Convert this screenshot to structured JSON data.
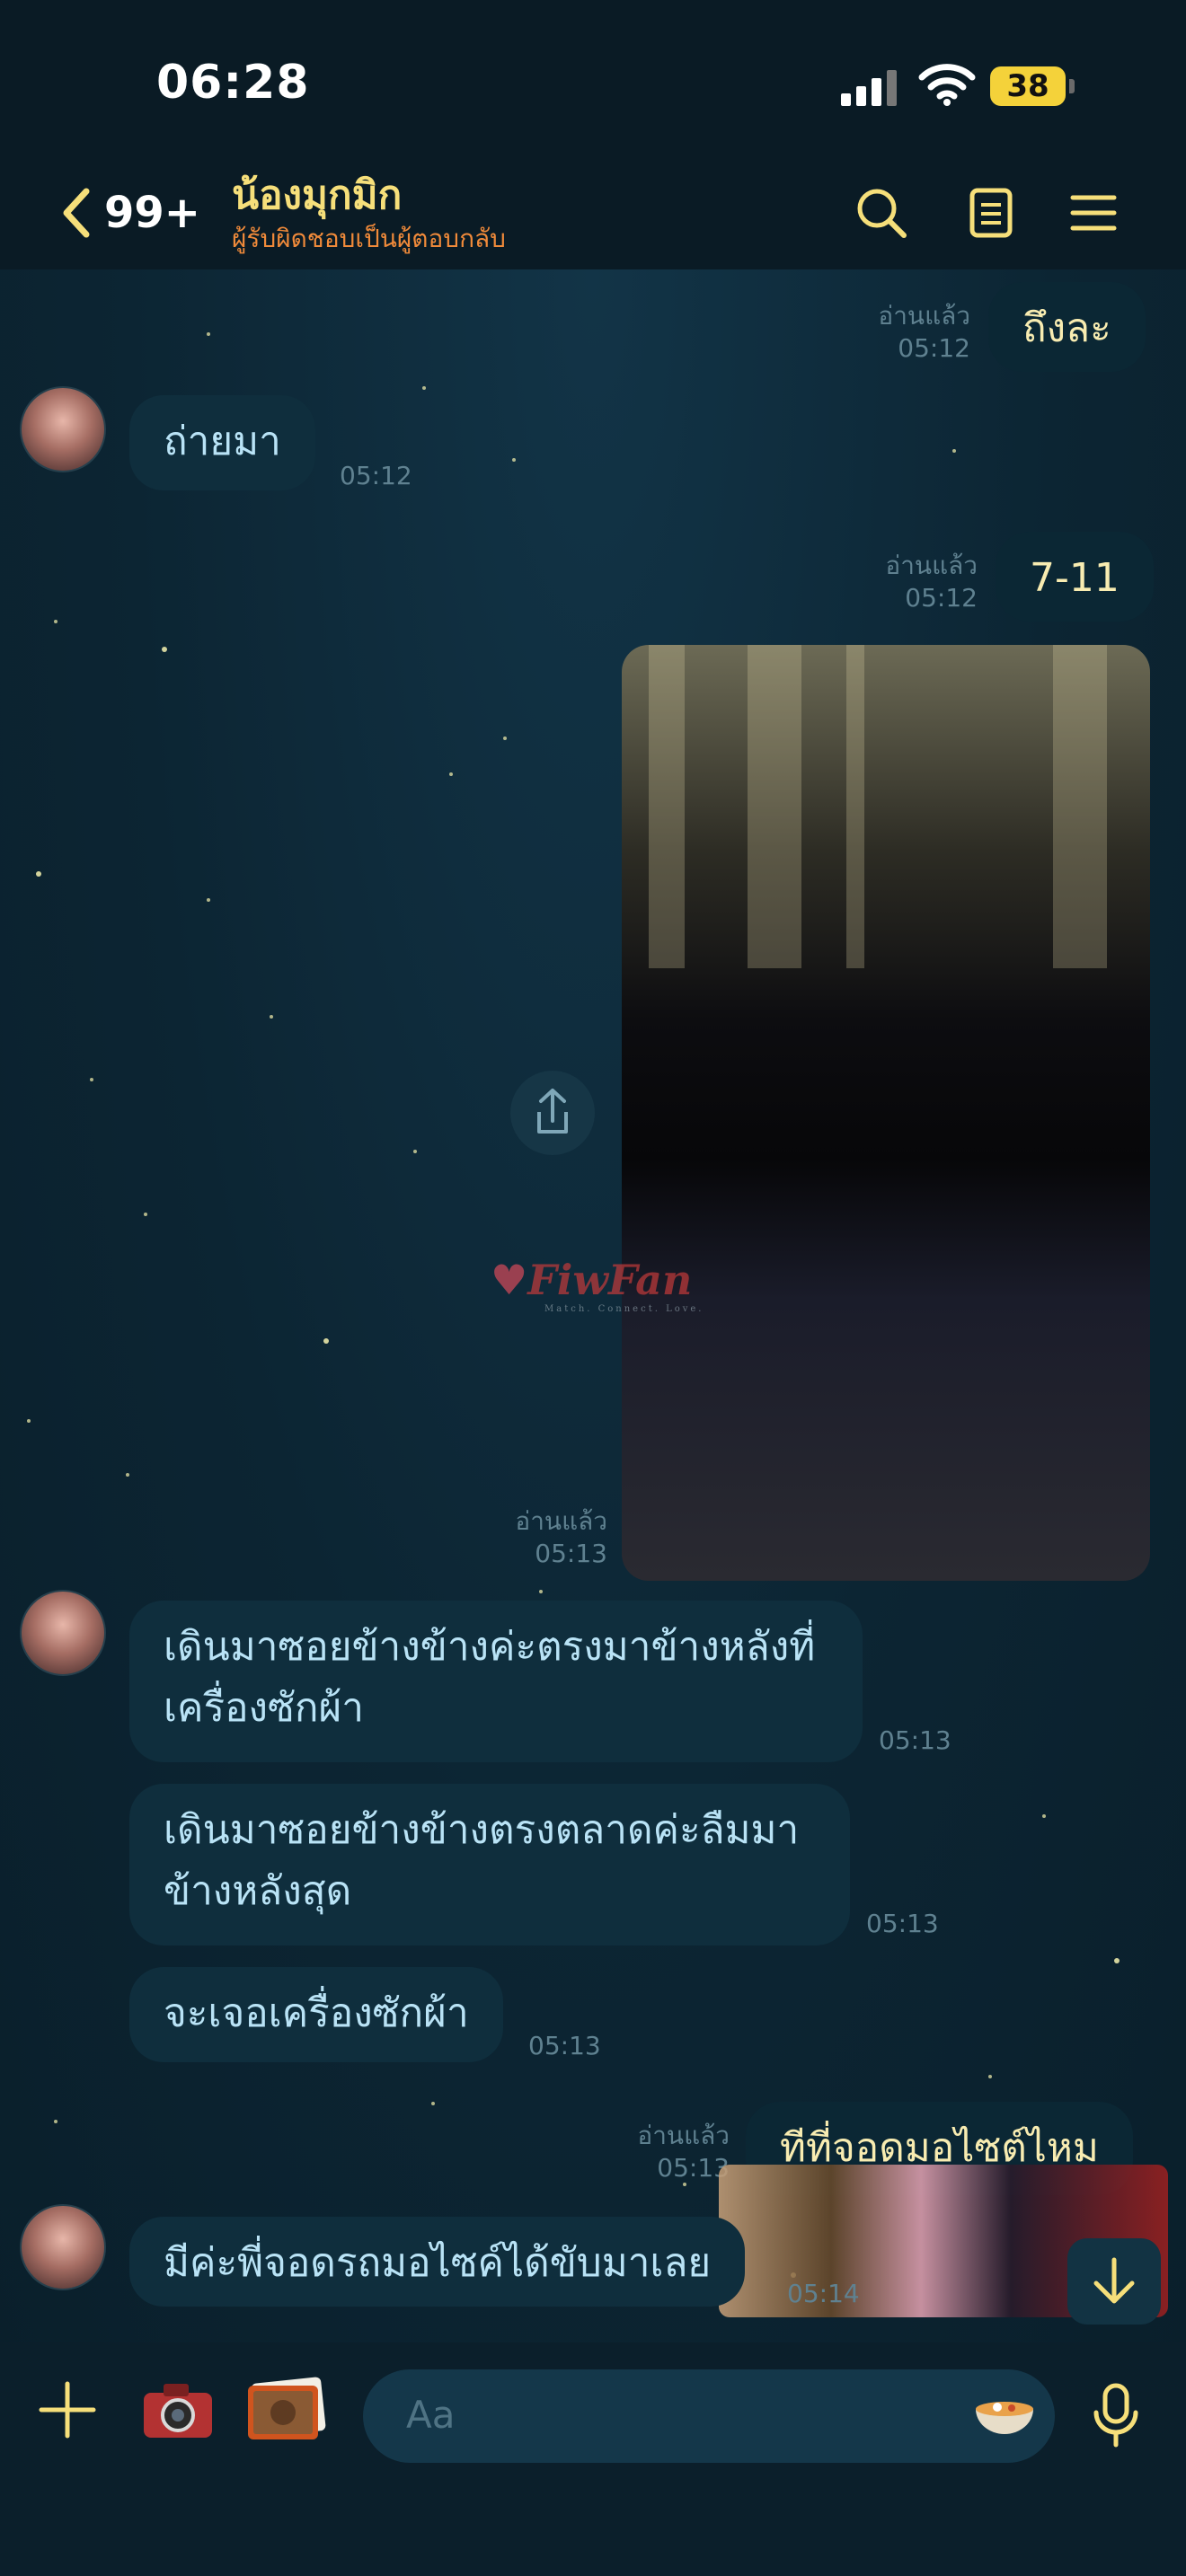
{
  "status_bar": {
    "time": "06:28",
    "battery": "38"
  },
  "header": {
    "back_count": "99+",
    "chat_name": "น้องมุกมิก",
    "subtitle": "ผู้รับผิดชอบเป็นผู้ตอบกลับ"
  },
  "messages": [
    {
      "direction": "out",
      "text": "ถึงละ",
      "read": "อ่านแล้ว",
      "time": "05:12"
    },
    {
      "direction": "in",
      "text": "ถ่ายมา",
      "time": "05:12"
    },
    {
      "direction": "out",
      "text": "7-11",
      "read": "อ่านแล้ว",
      "time": "05:12"
    },
    {
      "direction": "out",
      "type": "photo",
      "read": "อ่านแล้ว",
      "time": "05:13"
    },
    {
      "direction": "in",
      "text_line1": "เดินมาซอยข้างข้างค่ะตรงมาข้างหลังที่",
      "text_line2": "เครื่องซักผ้า",
      "time": "05:13"
    },
    {
      "direction": "in",
      "text_line1": "เดินมาซอยข้างข้างตรงตลาดค่ะลืมมา",
      "text_line2": "ข้างหลังสุด",
      "time": "05:13"
    },
    {
      "direction": "in",
      "text": "จะเจอเครื่องซักผ้า",
      "time": "05:13"
    },
    {
      "direction": "out",
      "text": "ทีที่จอดมอไซต์ไหม",
      "read": "อ่านแล้ว",
      "time": "05:13"
    },
    {
      "direction": "in",
      "text": "มีค่ะพี่จอดรถมอไซค์ได้ขับมาเลย",
      "time": "05:14"
    }
  ],
  "watermark": {
    "brand": "FiwFan",
    "tagline": "Match. Connect. Love."
  },
  "input": {
    "placeholder": "Aa"
  },
  "colors": {
    "accent": "#f6df7a",
    "subtitle": "#f08a3a",
    "battery": "#f4d23a"
  }
}
